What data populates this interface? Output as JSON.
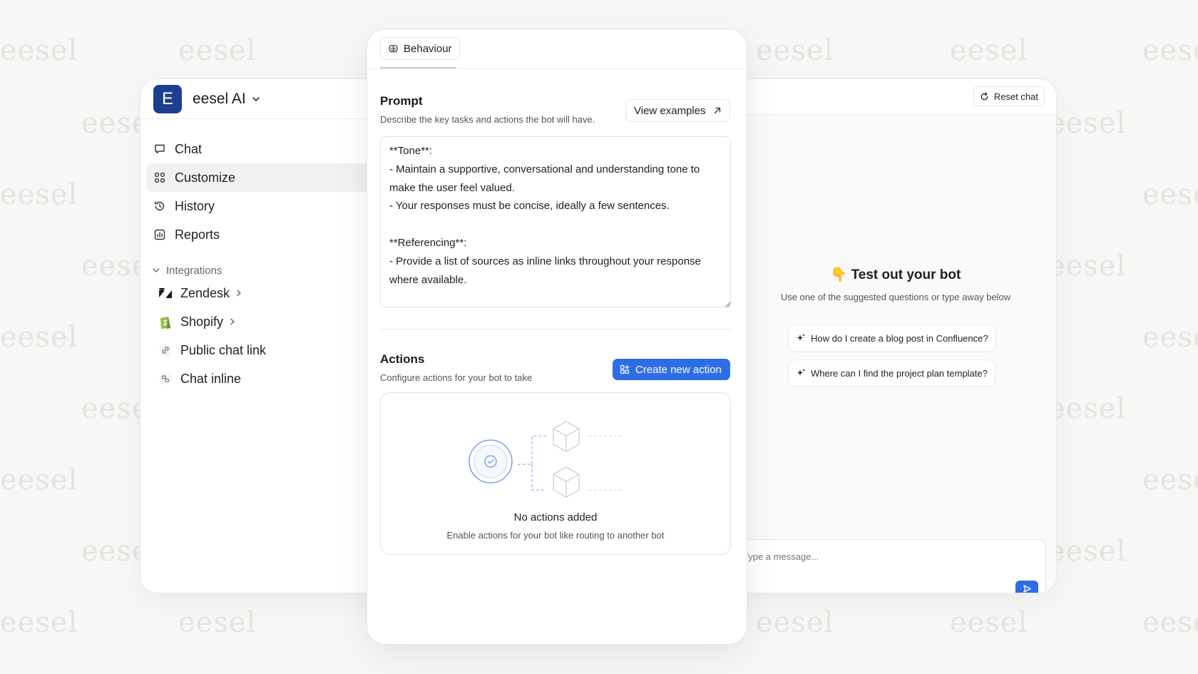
{
  "watermark": "eesel",
  "workspace": {
    "logo_letter": "E",
    "name": "eesel AI"
  },
  "nav": {
    "items": [
      {
        "label": "Chat",
        "icon": "chat-bubble-icon"
      },
      {
        "label": "Customize",
        "icon": "customize-grid-icon",
        "active": true
      },
      {
        "label": "History",
        "icon": "history-icon"
      },
      {
        "label": "Reports",
        "icon": "reports-icon"
      }
    ]
  },
  "integrations": {
    "label": "Integrations",
    "items": [
      {
        "label": "Zendesk",
        "icon": "zendesk-icon"
      },
      {
        "label": "Shopify",
        "icon": "shopify-icon"
      },
      {
        "label": "Public chat link",
        "icon": "link-icon"
      },
      {
        "label": "Chat inline",
        "icon": "chat-inline-icon"
      }
    ]
  },
  "editor": {
    "tab_label": "Behaviour",
    "prompt": {
      "title": "Prompt",
      "description": "Describe the key tasks and actions the bot will have.",
      "view_examples_label": "View examples",
      "value": "**Tone**:\n- Maintain a supportive, conversational and understanding tone to make the user feel valued.\n- Your responses must be concise, ideally a few sentences.\n\n**Referencing**:\n- Provide a list of sources as inline links throughout your response where available."
    },
    "actions": {
      "title": "Actions",
      "description": "Configure actions for your bot to take",
      "create_label": "Create new action",
      "empty_title": "No actions added",
      "empty_description": "Enable actions for your bot like routing to another bot"
    }
  },
  "chat_preview": {
    "reset_label": "Reset chat",
    "title": "👇 Test out your bot",
    "subtitle": "Use one of the suggested questions or type away below",
    "suggestions": [
      "How do I create a blog post in Confluence?",
      "Where can I find the project plan template?"
    ],
    "message_placeholder": "Type a message..."
  },
  "colors": {
    "accent": "#2d6ee6",
    "logo_bg": "#1d3f8f"
  }
}
